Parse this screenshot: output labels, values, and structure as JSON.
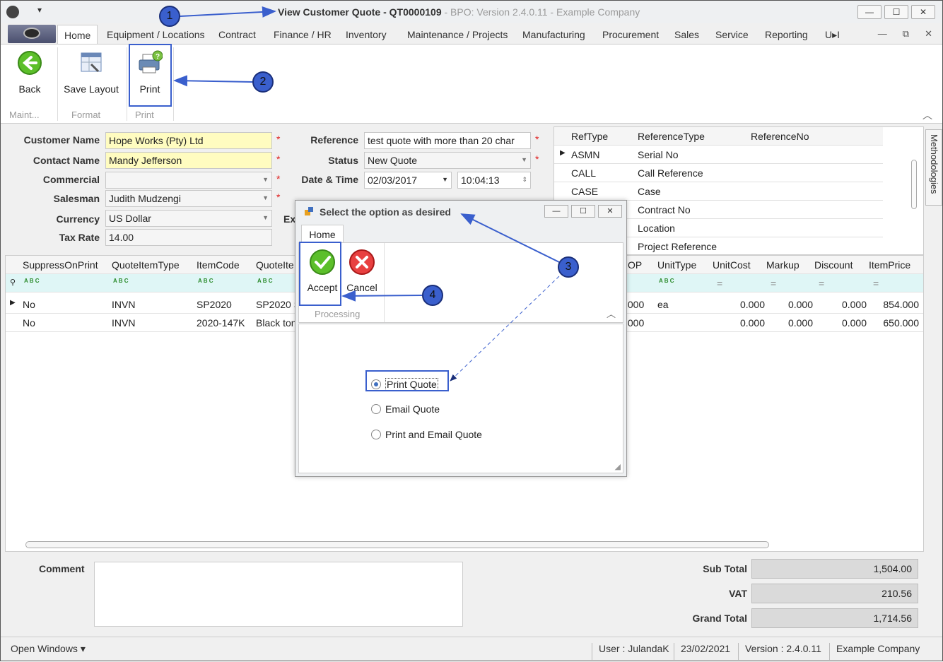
{
  "window": {
    "title": "View Customer Quote - QT0000109",
    "subtitle": " - BPO: Version 2.4.0.11 - Example Company",
    "minimize": "—",
    "maximize": "☐",
    "close": "✕",
    "qat_arrow": "▾"
  },
  "menu": {
    "tabs": [
      "Home",
      "Equipment / Locations",
      "Contract",
      "Finance / HR",
      "Inventory",
      "Maintenance / Projects",
      "Manufacturing",
      "Procurement",
      "Sales",
      "Service",
      "Reporting",
      "U▸I"
    ],
    "mdi": [
      "—",
      "⧉",
      "✕"
    ]
  },
  "ribbon": {
    "buttons": {
      "back": "Back",
      "save_layout": "Save Layout",
      "print": "Print"
    },
    "groups": {
      "maint": "Maint...",
      "format": "Format",
      "print": "Print"
    },
    "collapse": "︿"
  },
  "form": {
    "labels": {
      "customer_name": "Customer Name",
      "contact_name": "Contact Name",
      "commercial": "Commercial",
      "salesman": "Salesman",
      "currency": "Currency",
      "tax_rate": "Tax Rate",
      "reference": "Reference",
      "status": "Status",
      "date_time": "Date & Time",
      "ex": "Ex"
    },
    "values": {
      "customer_name": "Hope Works (Pty) Ltd",
      "contact_name": "Mandy Jefferson",
      "commercial": "",
      "salesman": "Judith Mudzengi",
      "currency": "US Dollar",
      "tax_rate": "14.00",
      "reference": "test quote with more than 20 char",
      "status": "New Quote",
      "date": "02/03/2017",
      "time": "10:04:13"
    },
    "required_mark": "*"
  },
  "references": {
    "headers": [
      "RefType",
      "ReferenceType",
      "ReferenceNo"
    ],
    "rows": [
      [
        "ASMN",
        "Serial No",
        ""
      ],
      [
        "CALL",
        "Call Reference",
        ""
      ],
      [
        "CASE",
        "Case",
        ""
      ],
      [
        "",
        "Contract No",
        ""
      ],
      [
        "",
        "Location",
        ""
      ],
      [
        "",
        "Project Reference",
        ""
      ]
    ]
  },
  "side_tab": "Methodologies",
  "items": {
    "headers": [
      "SuppressOnPrint",
      "QuoteItemType",
      "ItemCode",
      "QuoteIte",
      "OP",
      "UnitType",
      "UnitCost",
      "Markup",
      "Discount",
      "ItemPrice"
    ],
    "rows": [
      [
        "No",
        "INVN",
        "SP2020",
        "SP2020 S",
        ".000",
        "ea",
        "0.000",
        "0.000",
        "0.000",
        "854.000"
      ],
      [
        "No",
        "INVN",
        "2020-147K",
        "Black ton",
        ".000",
        "",
        "0.000",
        "0.000",
        "0.000",
        "650.000"
      ]
    ]
  },
  "bottom": {
    "comment_label": "Comment",
    "sub_total_label": "Sub Total",
    "vat_label": "VAT",
    "grand_total_label": "Grand Total",
    "sub_total": "1,504.00",
    "vat": "210.56",
    "grand_total": "1,714.56"
  },
  "status": {
    "open_windows": "Open Windows ▾",
    "user": "User : JulandaK",
    "date": "23/02/2021",
    "version": "Version : 2.4.0.11",
    "company": "Example Company"
  },
  "dialog": {
    "title": "Select the option as desired",
    "tab": "Home",
    "accept": "Accept",
    "cancel": "Cancel",
    "group": "Processing",
    "options": [
      "Print Quote",
      "Email Quote",
      "Print and Email Quote"
    ],
    "selected": "Print Quote"
  },
  "annotations": [
    "1",
    "2",
    "3",
    "4"
  ],
  "colors": {
    "accent": "#3a5fcd",
    "required": "#fffcc0",
    "filter_row": "#dff6f6"
  }
}
